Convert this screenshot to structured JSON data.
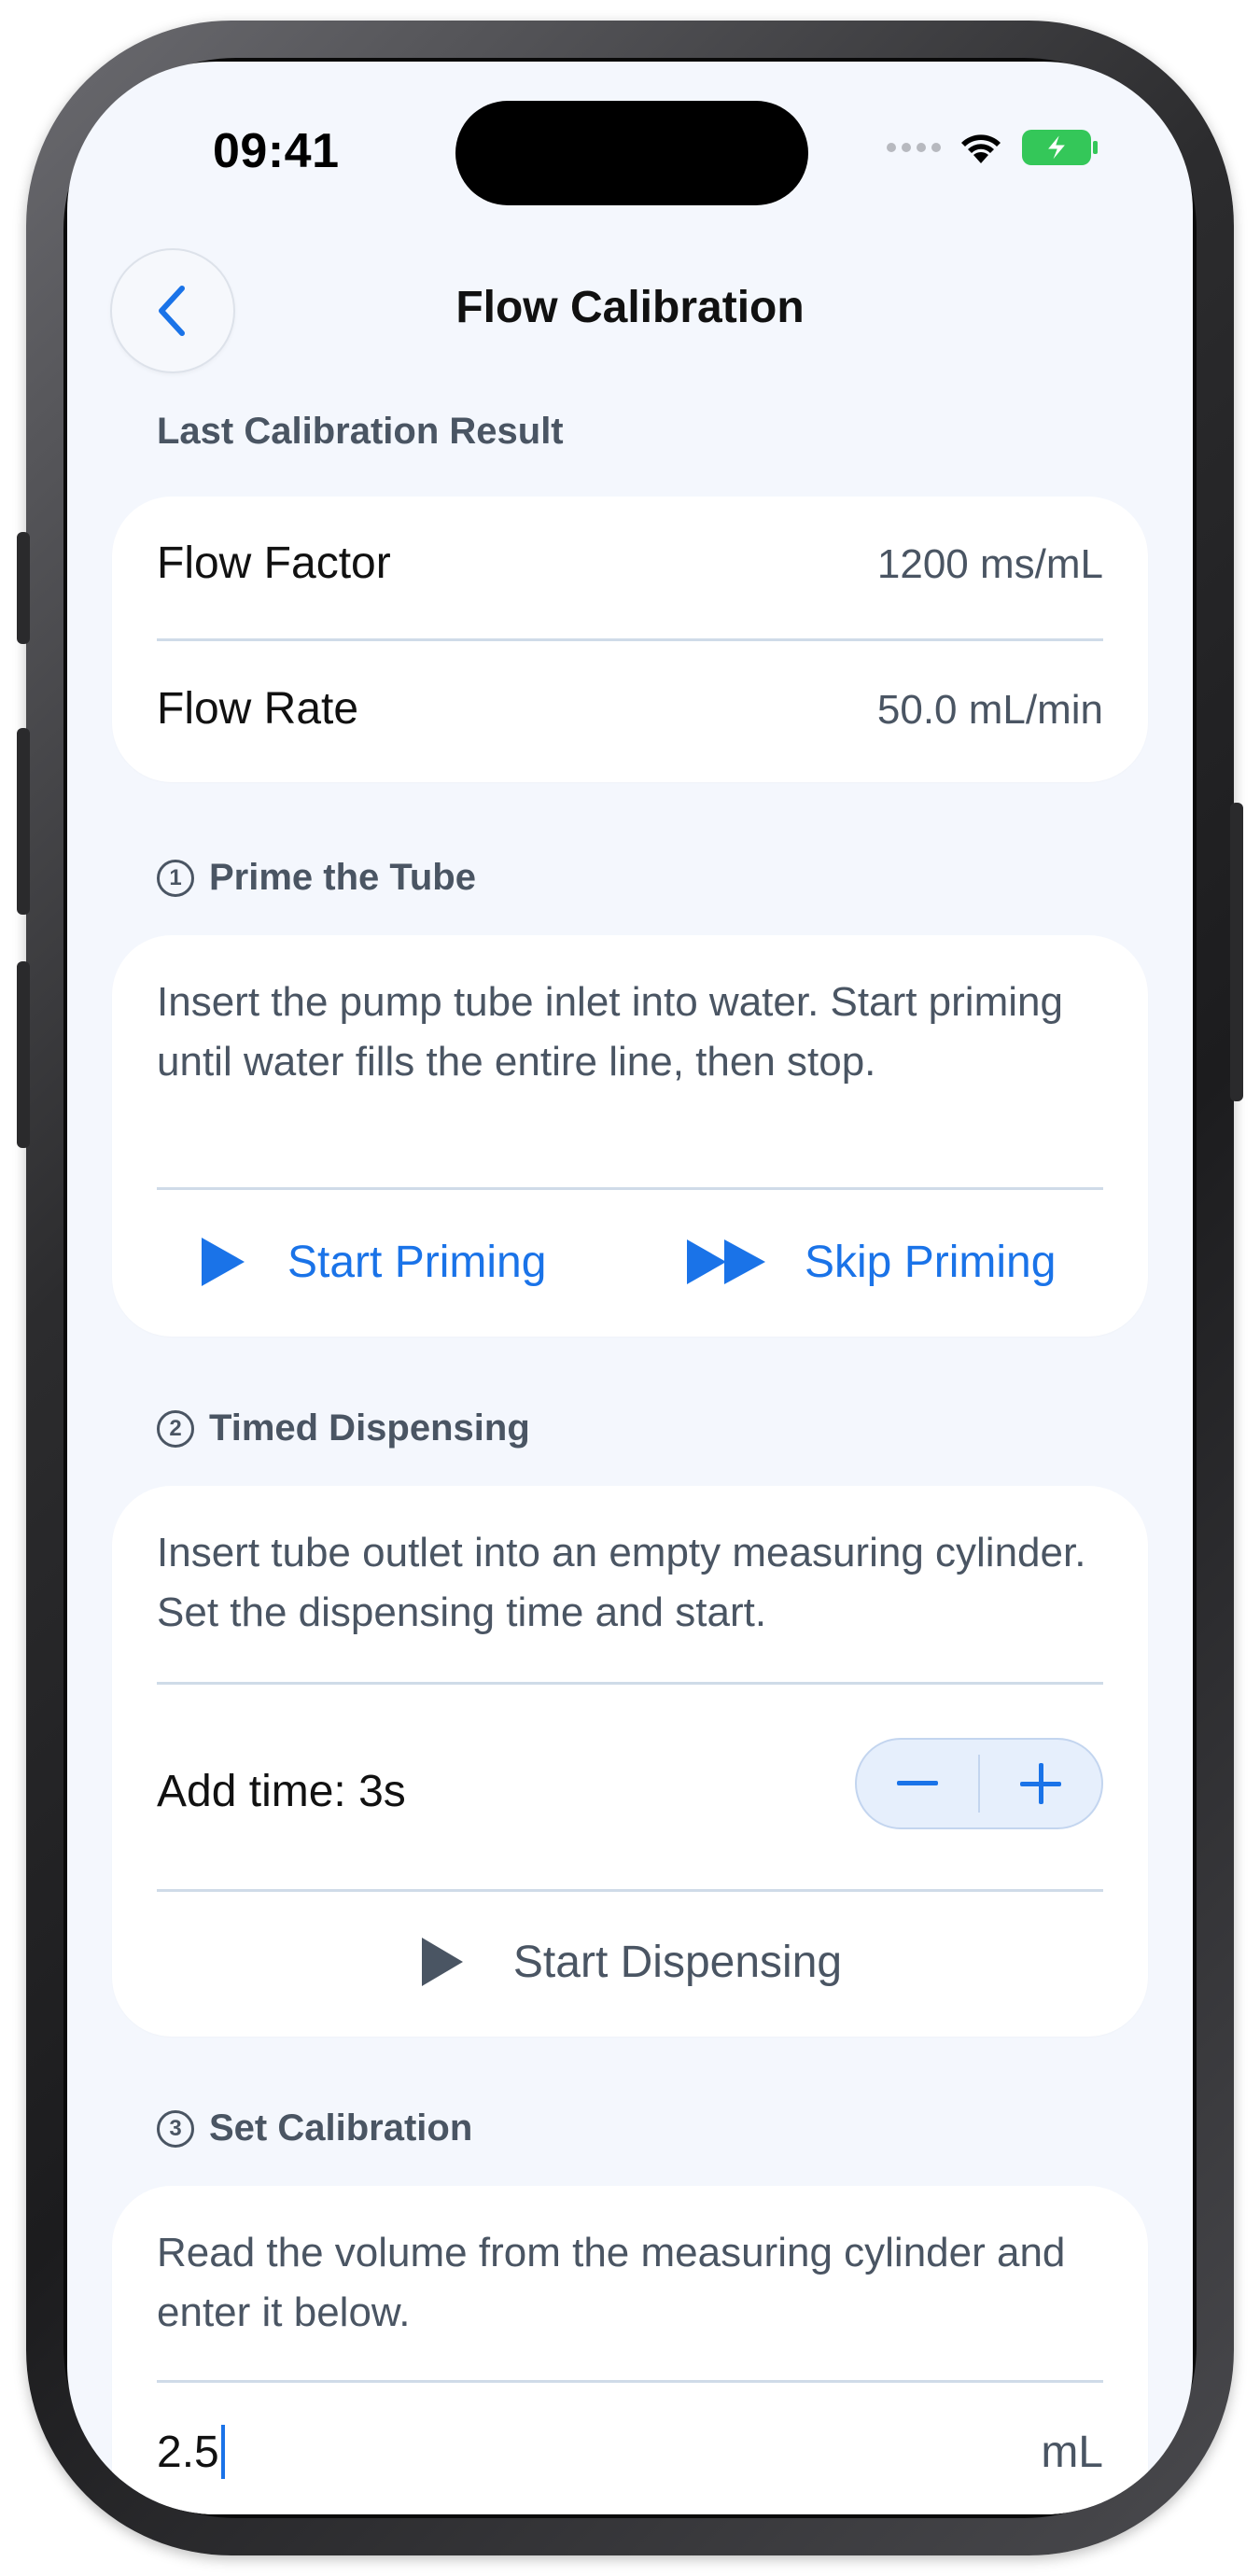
{
  "status_bar": {
    "time": "09:41"
  },
  "nav": {
    "title": "Flow Calibration"
  },
  "last_result": {
    "header": "Last Calibration Result",
    "rows": [
      {
        "label": "Flow Factor",
        "value": "1200 ms/mL"
      },
      {
        "label": "Flow Rate",
        "value": "50.0 mL/min"
      }
    ]
  },
  "step1": {
    "number": "1",
    "header": "Prime the Tube",
    "instructions": "Insert the pump tube inlet into water. Start priming until water fills the entire line, then stop.",
    "start_label": "Start Priming",
    "skip_label": "Skip Priming"
  },
  "step2": {
    "number": "2",
    "header": "Timed Dispensing",
    "instructions": "Insert tube outlet into an empty measuring cylinder. Set the dispensing time and start.",
    "time_label": "Add time: 3s",
    "dispense_label": "Start Dispensing"
  },
  "step3": {
    "number": "3",
    "header": "Set Calibration",
    "instructions": "Read the volume from the measuring cylinder and enter it below.",
    "volume_value": "2.5",
    "unit": "mL"
  },
  "colors": {
    "accent": "#1a73e8",
    "secondary_text": "#4a5563",
    "screen_bg": "#f4f7fd",
    "battery": "#34c759"
  }
}
